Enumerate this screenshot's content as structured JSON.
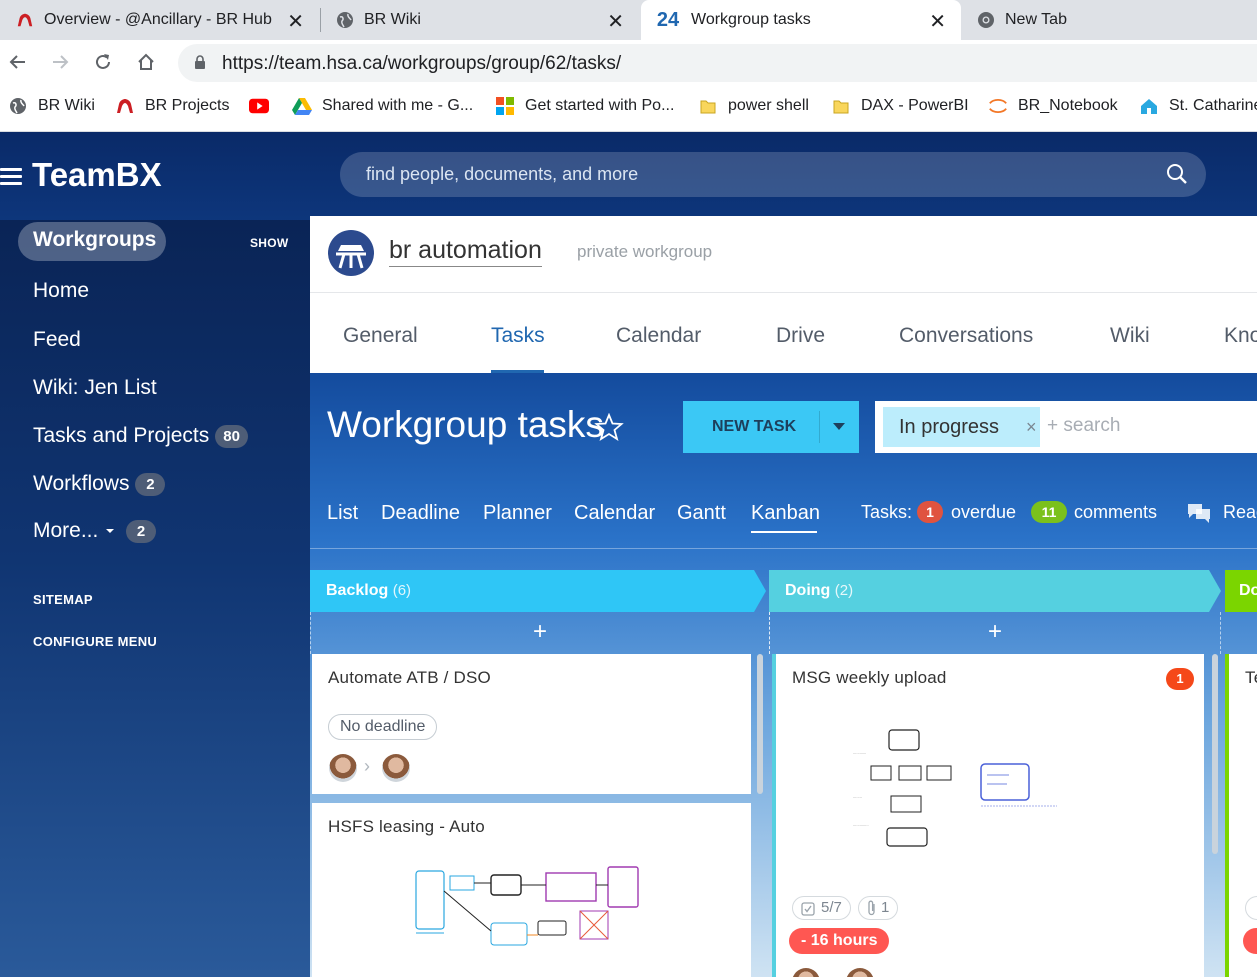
{
  "browser": {
    "tabs": [
      {
        "title": "Overview - @Ancillary - BR Hub",
        "icon": "redhat-icon",
        "close": "✕"
      },
      {
        "title": "BR Wiki",
        "icon": "globe-icon",
        "close": "✕"
      },
      {
        "title": "Workgroup tasks",
        "icon": "bitrix24-icon",
        "icon_text": "24",
        "close": "✕",
        "active": true
      },
      {
        "title": "New Tab",
        "icon": "chrome-icon"
      }
    ],
    "url": "https://team.hsa.ca/workgroups/group/62/tasks/",
    "bookmarks": [
      {
        "label": "BR Wiki",
        "icon": "globe-icon"
      },
      {
        "label": "BR Projects",
        "icon": "redhat-icon"
      },
      {
        "label": "",
        "icon": "youtube-icon"
      },
      {
        "label": "Shared with me - G...",
        "icon": "google-drive-icon"
      },
      {
        "label": "Get started with Po...",
        "icon": "microsoft-icon"
      },
      {
        "label": "power shell",
        "icon": "folder-icon"
      },
      {
        "label": "DAX - PowerBI",
        "icon": "folder-icon"
      },
      {
        "label": "BR_Notebook",
        "icon": "jupyter-icon"
      },
      {
        "label": "St. Catharine",
        "icon": "home-icon"
      }
    ]
  },
  "app": {
    "brand": "TeamBX",
    "search_placeholder": "find people, documents, and more"
  },
  "sidebar": {
    "section": "Workgroups",
    "show": "SHOW",
    "items": [
      {
        "label": "Home"
      },
      {
        "label": "Feed"
      },
      {
        "label": "Wiki: Jen List"
      },
      {
        "label": "Tasks and Projects",
        "badge": "80"
      },
      {
        "label": "Workflows",
        "badge": "2"
      },
      {
        "label": "More...",
        "badge": "2"
      }
    ],
    "sitemap": "SITEMAP",
    "configure": "CONFIGURE MENU"
  },
  "workgroup": {
    "name": "br automation",
    "type": "private workgroup",
    "tabs": [
      "General",
      "Tasks",
      "Calendar",
      "Drive",
      "Conversations",
      "Wiki",
      "Kno"
    ],
    "active_tab": "Tasks"
  },
  "tasks": {
    "title": "Workgroup tasks",
    "new_task": "NEW TASK",
    "filter_chip": "In progress",
    "filter_remove": "×",
    "search_placeholder": "+ search",
    "views": [
      "List",
      "Deadline",
      "Planner",
      "Calendar",
      "Gantt",
      "Kanban"
    ],
    "active_view": "Kanban",
    "counters_label": "Tasks:",
    "overdue_count": "1",
    "overdue_label": "overdue",
    "comments_count": "11",
    "comments_label": "comments",
    "read_label": "Read"
  },
  "kanban": {
    "add": "+",
    "columns": [
      {
        "name": "Backlog",
        "count": "(6)",
        "color": "#2fc6f6"
      },
      {
        "name": "Doing",
        "count": "(2)",
        "color": "#55d0e0"
      },
      {
        "name": "Do",
        "count": "",
        "color": "#7bd500"
      }
    ],
    "cards": [
      {
        "title": "Automate ATB / DSO",
        "deadline": "No deadline"
      },
      {
        "title": "HSFS leasing - Auto"
      },
      {
        "title": "MSG weekly upload",
        "badge": "1",
        "checklist": "5/7",
        "attachments": "1",
        "deadline": "- 16 hours"
      },
      {
        "title": "Te"
      }
    ]
  }
}
